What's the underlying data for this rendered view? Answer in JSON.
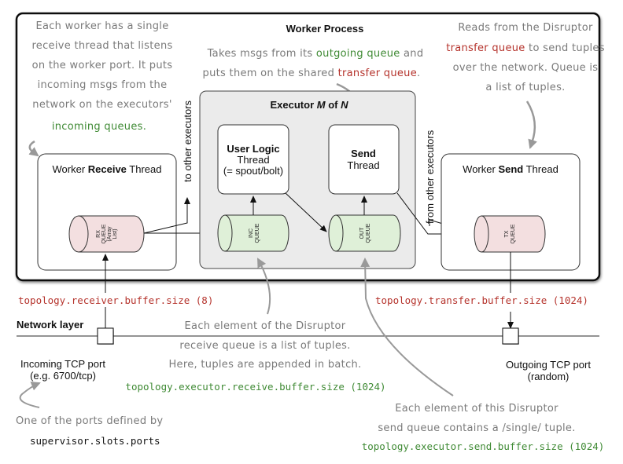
{
  "title": "Worker Process",
  "annotations": {
    "receive_thread_note": {
      "lines": [
        "Each worker has a single",
        "receive thread that listens",
        "on the worker port. It puts",
        "incoming msgs from the",
        "network on the executors'"
      ],
      "highlight": "incoming queues."
    },
    "send_thread_note": {
      "line1_prefix": "Takes msgs from its ",
      "line1_highlight": "outgoing queue",
      "line1_suffix": " and",
      "line2_prefix": "puts them on the shared ",
      "line2_highlight": "transfer queue",
      "line2_suffix": "."
    },
    "worker_send_note": {
      "line1": "Reads from the Disruptor",
      "line2_highlight": "transfer queue",
      "line2_suffix": " to send tuples",
      "line3": "over the network.  Queue is",
      "line4": "a list of tuples."
    },
    "receive_queue_note": {
      "lines": [
        "Each element of the Disruptor",
        "receive queue is a list of tuples.",
        "Here, tuples are appended in batch."
      ],
      "config": "topology.executor.receive.buffer.size (1024)"
    },
    "send_queue_note": {
      "lines": [
        "Each element of this Disruptor",
        "send queue contains a /single/ tuple."
      ],
      "config": "topology.executor.send.buffer.size (1024)"
    },
    "port_note": {
      "line": "One of the ports defined by",
      "config": "supervisor.slots.ports"
    }
  },
  "boxes": {
    "worker_receive_thread": {
      "prefix": "Worker ",
      "bold": "Receive",
      "suffix": " Thread"
    },
    "worker_send_thread": {
      "prefix": "Worker ",
      "bold": "Send",
      "suffix": " Thread"
    },
    "executor": {
      "prefix": "Executor ",
      "m": "M",
      "mid": " of ",
      "n": "N"
    },
    "user_logic": {
      "title": "User Logic",
      "line2": "Thread",
      "line3": "(= spout/bolt)"
    },
    "send": {
      "title": "Send",
      "line2": "Thread"
    }
  },
  "queues": {
    "rx": [
      "RX",
      "QUEUE",
      "(Array",
      "List)"
    ],
    "inc": [
      "INC",
      "QUEUE"
    ],
    "out": [
      "OUT",
      "QUEUE"
    ],
    "tx": [
      "TX",
      "QUEUE"
    ]
  },
  "side_labels": {
    "to_other": "to other executors",
    "from_other": "from other executors"
  },
  "config": {
    "receiver_buffer": "topology.receiver.buffer.size (8)",
    "transfer_buffer": "topology.transfer.buffer.size (1024)"
  },
  "network": {
    "label": "Network layer",
    "incoming_port": [
      "Incoming TCP port",
      "(e.g. 6700/tcp)"
    ],
    "outgoing_port": [
      "Outgoing TCP port",
      "(random)"
    ]
  },
  "colors": {
    "rx_tx_queue_fill": "#f3dfe0",
    "inc_out_queue_fill": "#dff0d8",
    "executor_fill": "#ebebeb",
    "note_gray": "#7a7a7a",
    "highlight_green": "#3f8a34",
    "highlight_red": "#b5332c"
  }
}
